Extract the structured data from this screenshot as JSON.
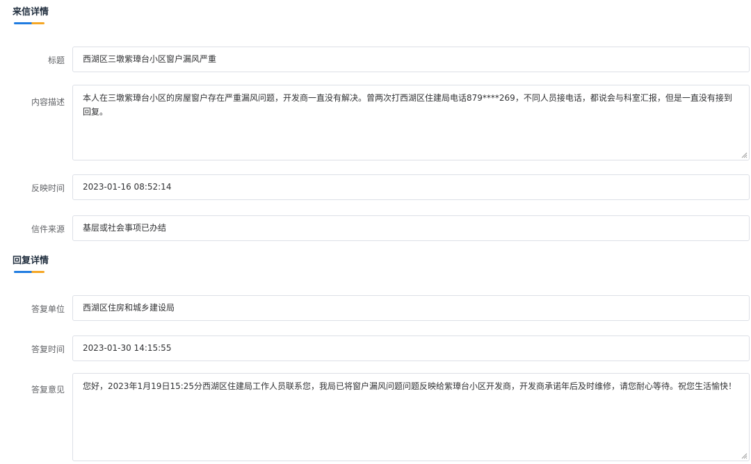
{
  "letter_section": {
    "title": "来信详情",
    "fields": [
      {
        "label": "标题",
        "value": "西湖区三墩紫璋台小区窗户漏风严重"
      },
      {
        "label": "内容描述",
        "value": "本人在三墩紫璋台小区的房屋窗户存在严重漏风问题，开发商一直没有解决。曾两次打西湖区住建局电话879****269，不同人员接电话，都说会与科室汇报，但是一直没有接到回复。"
      },
      {
        "label": "反映时间",
        "value": "2023-01-16 08:52:14"
      },
      {
        "label": "信件来源",
        "value": "基层或社会事项已办结"
      }
    ]
  },
  "reply_section": {
    "title": "回复详情",
    "fields": [
      {
        "label": "答复单位",
        "value": "西湖区住房和城乡建设局"
      },
      {
        "label": "答复时间",
        "value": "2023-01-30 14:15:55"
      },
      {
        "label": "答复意见",
        "value": "您好，2023年1月19日15:25分西湖区住建局工作人员联系您，我局已将窗户漏风问题问题反映给紫璋台小区开发商，开发商承诺年后及时维修，请您耐心等待。祝您生活愉快！"
      }
    ]
  },
  "colors": {
    "underline_blue": "#1f7be0",
    "underline_orange": "#f5a623",
    "border": "#dcdfe6"
  }
}
